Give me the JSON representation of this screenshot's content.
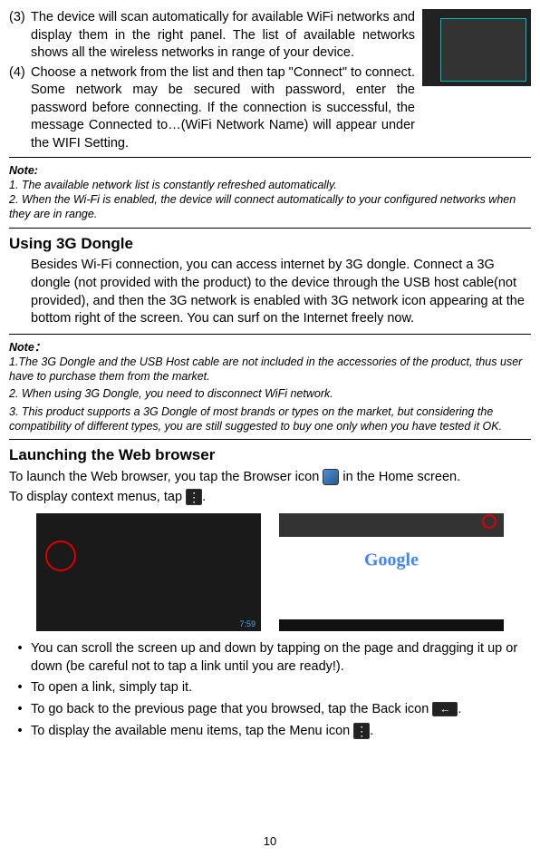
{
  "step3": {
    "num": "(3)",
    "text": "The device will scan automatically for available WiFi networks and display them in the right panel. The list of available networks shows all the wireless networks in range of your device."
  },
  "step4": {
    "num": "(4)",
    "text": "Choose a network from the list and then tap \"Connect\" to connect. Some network may be secured with password, enter the password before connecting. If the connection is successful, the message Connected to…(WiFi Network Name) will appear under the WIFI Setting."
  },
  "note1": {
    "title": "Note:",
    "line1": "1. The available network list is constantly refreshed automatically.",
    "line2": "2. When the Wi-Fi is enabled, the device will connect automatically to your configured networks when they are in range."
  },
  "section1": {
    "heading": "Using 3G Dongle",
    "para": "Besides Wi-Fi connection, you can access internet by 3G dongle. Connect a 3G dongle (not provided with the product) to the device through the USB host cable(not provided), and then the 3G network is enabled with 3G network icon appearing at the bottom right of the screen. You can surf on the Internet freely now."
  },
  "note2": {
    "title": "Note：",
    "line1": "1.The 3G Dongle and the USB Host cable are not included in the accessories of the product, thus user have to purchase them from the market.",
    "line2": "2. When using 3G Dongle, you need to disconnect WiFi network.",
    "line3": "3. This product supports a 3G Dongle of most brands or types on the market, but considering the compatibility of different types, you are still suggested to buy one only when you have tested it OK."
  },
  "section2": {
    "heading": "Launching the Web browser",
    "para1a": "To launch the Web browser, you tap the Browser icon ",
    "para1b": " in the Home screen.",
    "para2a": "To display context menus, tap ",
    "para2b": "."
  },
  "bullets": {
    "b1": "You can scroll the screen up and down by tapping on the page and dragging it up or down (be careful not to tap a link until you are ready!).",
    "b2": "To open a link, simply tap it.",
    "b3a": "To go back to the previous page that you browsed, tap the Back icon ",
    "b3b": ".",
    "b4a": "To display the available menu items, tap the Menu icon ",
    "b4b": "."
  },
  "pageNum": "10"
}
